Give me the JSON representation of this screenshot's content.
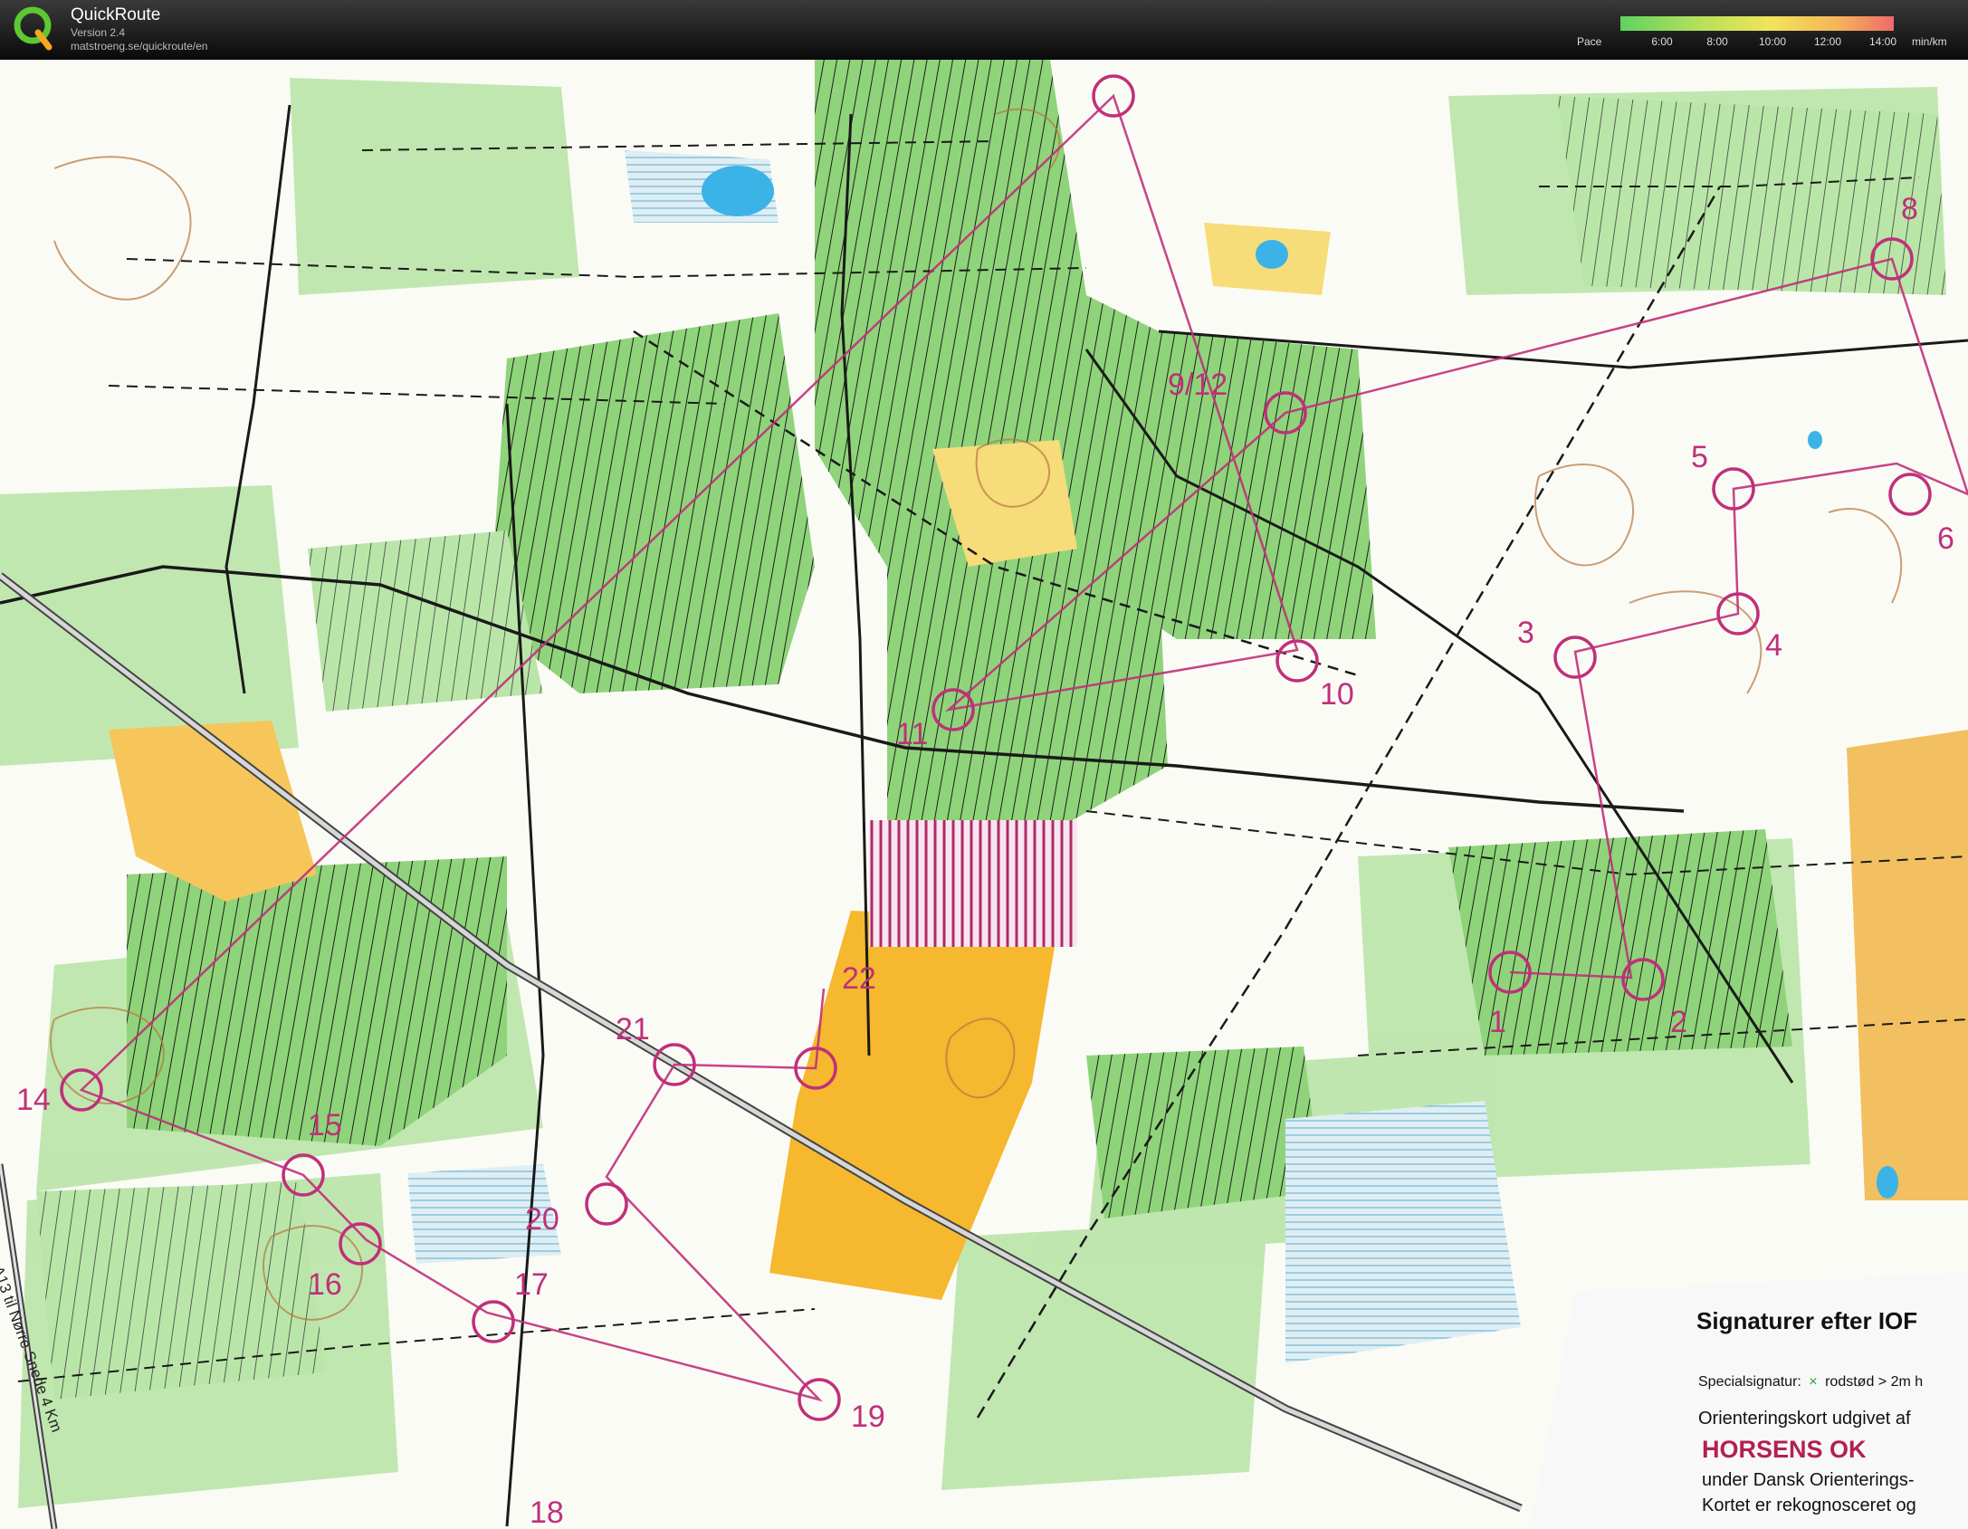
{
  "header": {
    "app_name": "QuickRoute",
    "version": "Version 2.4",
    "url": "matstroeng.se/quickroute/en",
    "pace_label": "Pace",
    "pace_ticks": [
      "6:00",
      "8:00",
      "10:00",
      "12:00",
      "14:00"
    ],
    "pace_unit": "min/km",
    "pace_colors": [
      "#5fd35f",
      "#b9e05a",
      "#f2e45a",
      "#f5b35a",
      "#ee6a6a"
    ]
  },
  "map": {
    "side_road_label": "A13 til Nørre Snede 4 Km",
    "legend": {
      "title": "Signaturer efter IOF",
      "special_prefix": "Specialsignatur:",
      "special_item": "rodstød > 2m h",
      "published_by": "Orienteringskort udgivet af",
      "club": "HORSENS OK",
      "under": "under Dansk Orienterings-",
      "map_note": "Kortet er rekognosceret og"
    },
    "controls": [
      "1",
      "2",
      "3",
      "4",
      "5",
      "6",
      "8",
      "9/12",
      "10",
      "11",
      "14",
      "15",
      "16",
      "17",
      "18",
      "19",
      "20",
      "21",
      "22"
    ],
    "course_color": "#c0307a"
  }
}
